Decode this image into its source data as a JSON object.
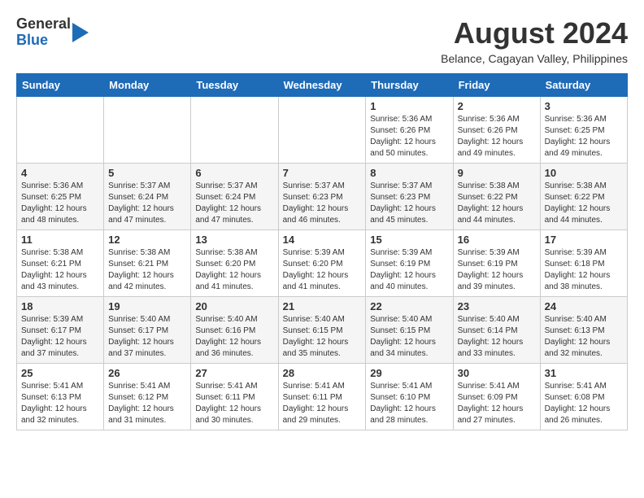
{
  "header": {
    "logo_line1": "General",
    "logo_line2": "Blue",
    "month_year": "August 2024",
    "location": "Belance, Cagayan Valley, Philippines"
  },
  "days_of_week": [
    "Sunday",
    "Monday",
    "Tuesday",
    "Wednesday",
    "Thursday",
    "Friday",
    "Saturday"
  ],
  "weeks": [
    [
      {
        "day": "",
        "info": ""
      },
      {
        "day": "",
        "info": ""
      },
      {
        "day": "",
        "info": ""
      },
      {
        "day": "",
        "info": ""
      },
      {
        "day": "1",
        "info": "Sunrise: 5:36 AM\nSunset: 6:26 PM\nDaylight: 12 hours\nand 50 minutes."
      },
      {
        "day": "2",
        "info": "Sunrise: 5:36 AM\nSunset: 6:26 PM\nDaylight: 12 hours\nand 49 minutes."
      },
      {
        "day": "3",
        "info": "Sunrise: 5:36 AM\nSunset: 6:25 PM\nDaylight: 12 hours\nand 49 minutes."
      }
    ],
    [
      {
        "day": "4",
        "info": "Sunrise: 5:36 AM\nSunset: 6:25 PM\nDaylight: 12 hours\nand 48 minutes."
      },
      {
        "day": "5",
        "info": "Sunrise: 5:37 AM\nSunset: 6:24 PM\nDaylight: 12 hours\nand 47 minutes."
      },
      {
        "day": "6",
        "info": "Sunrise: 5:37 AM\nSunset: 6:24 PM\nDaylight: 12 hours\nand 47 minutes."
      },
      {
        "day": "7",
        "info": "Sunrise: 5:37 AM\nSunset: 6:23 PM\nDaylight: 12 hours\nand 46 minutes."
      },
      {
        "day": "8",
        "info": "Sunrise: 5:37 AM\nSunset: 6:23 PM\nDaylight: 12 hours\nand 45 minutes."
      },
      {
        "day": "9",
        "info": "Sunrise: 5:38 AM\nSunset: 6:22 PM\nDaylight: 12 hours\nand 44 minutes."
      },
      {
        "day": "10",
        "info": "Sunrise: 5:38 AM\nSunset: 6:22 PM\nDaylight: 12 hours\nand 44 minutes."
      }
    ],
    [
      {
        "day": "11",
        "info": "Sunrise: 5:38 AM\nSunset: 6:21 PM\nDaylight: 12 hours\nand 43 minutes."
      },
      {
        "day": "12",
        "info": "Sunrise: 5:38 AM\nSunset: 6:21 PM\nDaylight: 12 hours\nand 42 minutes."
      },
      {
        "day": "13",
        "info": "Sunrise: 5:38 AM\nSunset: 6:20 PM\nDaylight: 12 hours\nand 41 minutes."
      },
      {
        "day": "14",
        "info": "Sunrise: 5:39 AM\nSunset: 6:20 PM\nDaylight: 12 hours\nand 41 minutes."
      },
      {
        "day": "15",
        "info": "Sunrise: 5:39 AM\nSunset: 6:19 PM\nDaylight: 12 hours\nand 40 minutes."
      },
      {
        "day": "16",
        "info": "Sunrise: 5:39 AM\nSunset: 6:19 PM\nDaylight: 12 hours\nand 39 minutes."
      },
      {
        "day": "17",
        "info": "Sunrise: 5:39 AM\nSunset: 6:18 PM\nDaylight: 12 hours\nand 38 minutes."
      }
    ],
    [
      {
        "day": "18",
        "info": "Sunrise: 5:39 AM\nSunset: 6:17 PM\nDaylight: 12 hours\nand 37 minutes."
      },
      {
        "day": "19",
        "info": "Sunrise: 5:40 AM\nSunset: 6:17 PM\nDaylight: 12 hours\nand 37 minutes."
      },
      {
        "day": "20",
        "info": "Sunrise: 5:40 AM\nSunset: 6:16 PM\nDaylight: 12 hours\nand 36 minutes."
      },
      {
        "day": "21",
        "info": "Sunrise: 5:40 AM\nSunset: 6:15 PM\nDaylight: 12 hours\nand 35 minutes."
      },
      {
        "day": "22",
        "info": "Sunrise: 5:40 AM\nSunset: 6:15 PM\nDaylight: 12 hours\nand 34 minutes."
      },
      {
        "day": "23",
        "info": "Sunrise: 5:40 AM\nSunset: 6:14 PM\nDaylight: 12 hours\nand 33 minutes."
      },
      {
        "day": "24",
        "info": "Sunrise: 5:40 AM\nSunset: 6:13 PM\nDaylight: 12 hours\nand 32 minutes."
      }
    ],
    [
      {
        "day": "25",
        "info": "Sunrise: 5:41 AM\nSunset: 6:13 PM\nDaylight: 12 hours\nand 32 minutes."
      },
      {
        "day": "26",
        "info": "Sunrise: 5:41 AM\nSunset: 6:12 PM\nDaylight: 12 hours\nand 31 minutes."
      },
      {
        "day": "27",
        "info": "Sunrise: 5:41 AM\nSunset: 6:11 PM\nDaylight: 12 hours\nand 30 minutes."
      },
      {
        "day": "28",
        "info": "Sunrise: 5:41 AM\nSunset: 6:11 PM\nDaylight: 12 hours\nand 29 minutes."
      },
      {
        "day": "29",
        "info": "Sunrise: 5:41 AM\nSunset: 6:10 PM\nDaylight: 12 hours\nand 28 minutes."
      },
      {
        "day": "30",
        "info": "Sunrise: 5:41 AM\nSunset: 6:09 PM\nDaylight: 12 hours\nand 27 minutes."
      },
      {
        "day": "31",
        "info": "Sunrise: 5:41 AM\nSunset: 6:08 PM\nDaylight: 12 hours\nand 26 minutes."
      }
    ]
  ]
}
